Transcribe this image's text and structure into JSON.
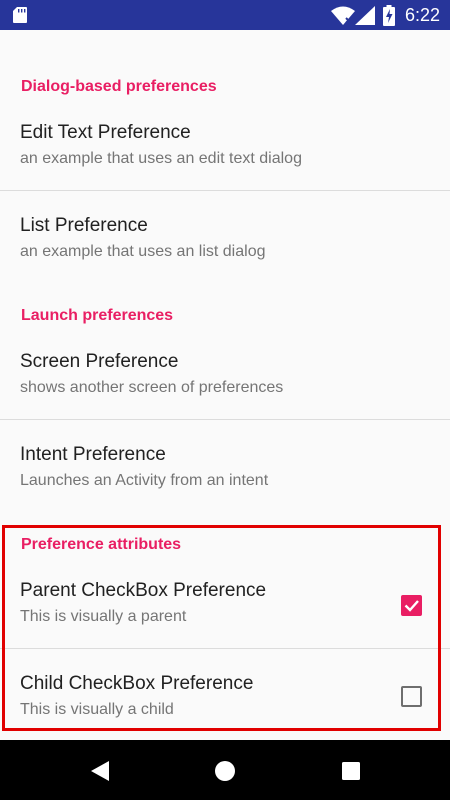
{
  "status_bar": {
    "time": "6:22",
    "battery_glyph": "ϟ",
    "icons": [
      "sd-card-icon",
      "wifi-icon",
      "cell-signal-icon",
      "battery-charging-icon"
    ]
  },
  "categories": {
    "dialog": "Dialog-based preferences",
    "launch": "Launch preferences",
    "attributes": "Preference attributes"
  },
  "preferences": {
    "edit_text": {
      "title": "Edit Text Preference",
      "summary": "an example that uses an edit text dialog"
    },
    "list": {
      "title": "List Preference",
      "summary": "an example that uses an list dialog"
    },
    "screen": {
      "title": "Screen Preference",
      "summary": "shows another screen of preferences"
    },
    "intent": {
      "title": "Intent Preference",
      "summary": "Launches an Activity from an intent"
    },
    "parent_checkbox": {
      "title": "Parent CheckBox Preference",
      "summary": "This is visually a parent",
      "checked": true
    },
    "child_checkbox": {
      "title": "Child CheckBox Preference",
      "summary": "This is visually a child",
      "checked": false
    }
  },
  "colors": {
    "status_bar": "#27359a",
    "accent": "#e91e63",
    "highlight": "#e10000",
    "navigation_bar": "#000000"
  },
  "navigation_bar": {
    "buttons": [
      "back-icon",
      "home-icon",
      "recents-icon"
    ]
  }
}
